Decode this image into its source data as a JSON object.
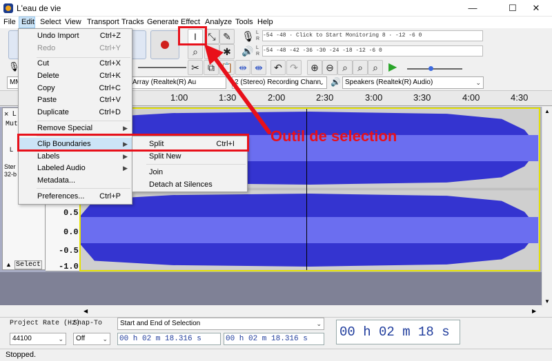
{
  "window": {
    "title": "L'eau de vie",
    "controls": [
      "—",
      "☐",
      "✕"
    ]
  },
  "menubar": {
    "items": [
      "File",
      "Edit",
      "Select",
      "View",
      "Transport",
      "Tracks",
      "Generate",
      "Effect",
      "Analyze",
      "Tools",
      "Help"
    ]
  },
  "edit_menu": {
    "items": [
      {
        "label": "Undo Import",
        "shortcut": "Ctrl+Z"
      },
      {
        "label": "Redo",
        "shortcut": "Ctrl+Y"
      },
      {
        "label": "Cut",
        "shortcut": "Ctrl+X"
      },
      {
        "label": "Delete",
        "shortcut": "Ctrl+K"
      },
      {
        "label": "Copy",
        "shortcut": "Ctrl+C"
      },
      {
        "label": "Paste",
        "shortcut": "Ctrl+V"
      },
      {
        "label": "Duplicate",
        "shortcut": "Ctrl+D"
      },
      {
        "label": "Remove Special",
        "shortcut": ""
      },
      {
        "label": "Clip Boundaries",
        "shortcut": ""
      },
      {
        "label": "Labels",
        "shortcut": ""
      },
      {
        "label": "Labeled Audio",
        "shortcut": ""
      },
      {
        "label": "Metadata...",
        "shortcut": ""
      },
      {
        "label": "Preferences...",
        "shortcut": "Ctrl+P"
      }
    ]
  },
  "clip_boundaries_submenu": {
    "items": [
      {
        "label": "Split",
        "shortcut": "Ctrl+I"
      },
      {
        "label": "Split New",
        "shortcut": ""
      },
      {
        "label": "Join",
        "shortcut": ""
      },
      {
        "label": "Detach at Silences",
        "shortcut": ""
      }
    ]
  },
  "meters": {
    "record_scale": "-54  -48  · Click to Start Monitoring 8  · -12   -6   0",
    "play_scale": "-54  -48  -42  -36  -30  -24  -18  -12   -6   0",
    "channel_left": "L",
    "channel_right": "R"
  },
  "devices": {
    "host": "MM",
    "recording_device": "Array (Realtek(R) Au",
    "recording_channels": "2 (Stereo) Recording Chann",
    "playback_device": "Speakers (Realtek(R) Audio)"
  },
  "timeline": {
    "labels": [
      "1:00",
      "1:30",
      "2:00",
      "2:30",
      "3:00",
      "3:30",
      "4:00",
      "4:30"
    ]
  },
  "track": {
    "close": "×",
    "name_stub": "L",
    "mute_stub": "Mut",
    "gain_stub": "L",
    "info_line1": "Ster",
    "info_line2": "32-b",
    "select_label": "Select",
    "collapse_glyph": "▲",
    "amplitude_labels": [
      "0.5",
      "0.0",
      "-0.5",
      "-1.0"
    ]
  },
  "selection_toolbar": {
    "project_rate_label": "Project Rate (Hz)",
    "project_rate_value": "44100",
    "snap_label": "Snap-To",
    "snap_value": "Off",
    "mode_value": "Start and End of Selection",
    "start_time": "00 h 02 m 18.316 s",
    "end_time": "00 h 02 m 18.316 s",
    "audio_position": "00 h 02 m 18 s"
  },
  "status": {
    "text": "Stopped."
  },
  "annotation": {
    "text": "Outil de selection"
  }
}
